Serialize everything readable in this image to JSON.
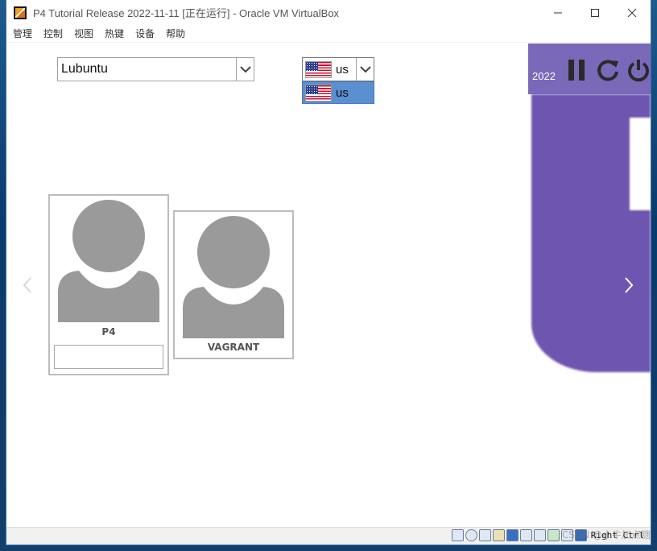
{
  "window": {
    "title": "P4 Tutorial Release 2022-11-11 [正在运行] - Oracle VM VirtualBox",
    "minimize_glyph": "—",
    "maximize_glyph": "☐",
    "close_glyph": "✕"
  },
  "menubar": {
    "items": [
      "管理",
      "控制",
      "视图",
      "热键",
      "设备",
      "帮助"
    ]
  },
  "login": {
    "session_value": "Lubuntu",
    "keyboard_layout_value": "us",
    "keyboard_layout_options": [
      "us"
    ],
    "brand_year": "2022",
    "users": [
      {
        "name": "P4",
        "has_password_field": true
      },
      {
        "name": "VAGRANT",
        "has_password_field": false
      }
    ]
  },
  "statusbar": {
    "host_key": "Right Ctrl",
    "icon_names": [
      "hard-disk-icon",
      "optical-drive-icon",
      "network-icon",
      "shared-folders-icon",
      "display-icon",
      "usb-icon",
      "recording-icon",
      "cpu-icon",
      "mouse-integration-icon",
      "keyboard-icon"
    ]
  },
  "overlay": {
    "watermark": "CSDN @小牛加点糖"
  },
  "colors": {
    "brand_purple": "#6d55b0",
    "brand_top": "#7a68b8",
    "selection_blue": "#5a8fd0",
    "avatar_gray": "#9a9a9a"
  }
}
